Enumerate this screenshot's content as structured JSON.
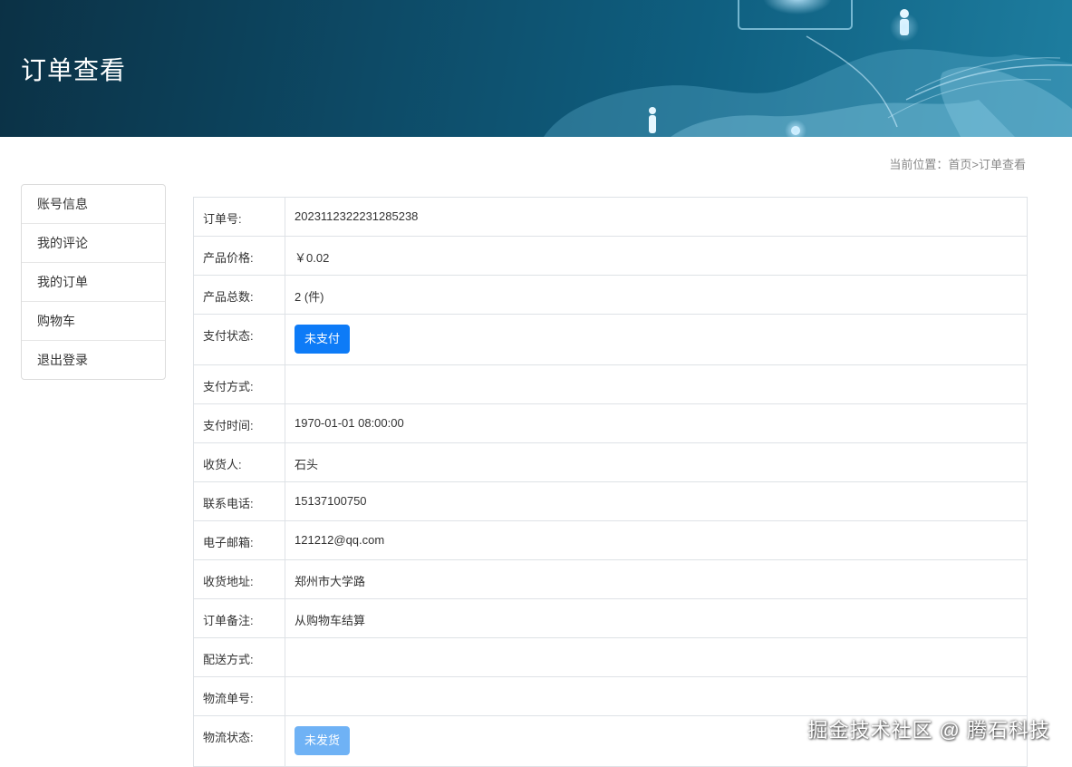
{
  "banner": {
    "title": "订单查看"
  },
  "breadcrumb": {
    "prefix": "当前位置：",
    "home": "首页",
    "separator": ">",
    "current": "订单查看"
  },
  "sidebar": {
    "items": [
      {
        "label": "账号信息"
      },
      {
        "label": "我的评论"
      },
      {
        "label": "我的订单"
      },
      {
        "label": "购物车"
      },
      {
        "label": "退出登录"
      }
    ]
  },
  "order": {
    "order_no_label": "订单号:",
    "order_no": "2023112322231285238",
    "price_label": "产品价格:",
    "price": "￥0.02",
    "quantity_label": "产品总数:",
    "quantity": "2 (件)",
    "pay_status_label": "支付状态:",
    "pay_status": "未支付",
    "pay_method_label": "支付方式:",
    "pay_method": "",
    "pay_time_label": "支付时间:",
    "pay_time": "1970-01-01 08:00:00",
    "receiver_label": "收货人:",
    "receiver": "石头",
    "phone_label": "联系电话:",
    "phone": "15137100750",
    "email_label": "电子邮箱:",
    "email": "121212@qq.com",
    "address_label": "收货地址:",
    "address": "郑州市大学路",
    "note_label": "订单备注:",
    "note": "从购物车结算",
    "delivery_method_label": "配送方式:",
    "delivery_method": "",
    "tracking_no_label": "物流单号:",
    "tracking_no": "",
    "logistics_status_label": "物流状态:",
    "logistics_status": "未发货"
  },
  "colors": {
    "primary": "#0d7bf7",
    "primary_light": "#6fb2f5",
    "banner": "#0d4a66"
  },
  "watermark": "掘金技术社区 @ 腾石科技"
}
